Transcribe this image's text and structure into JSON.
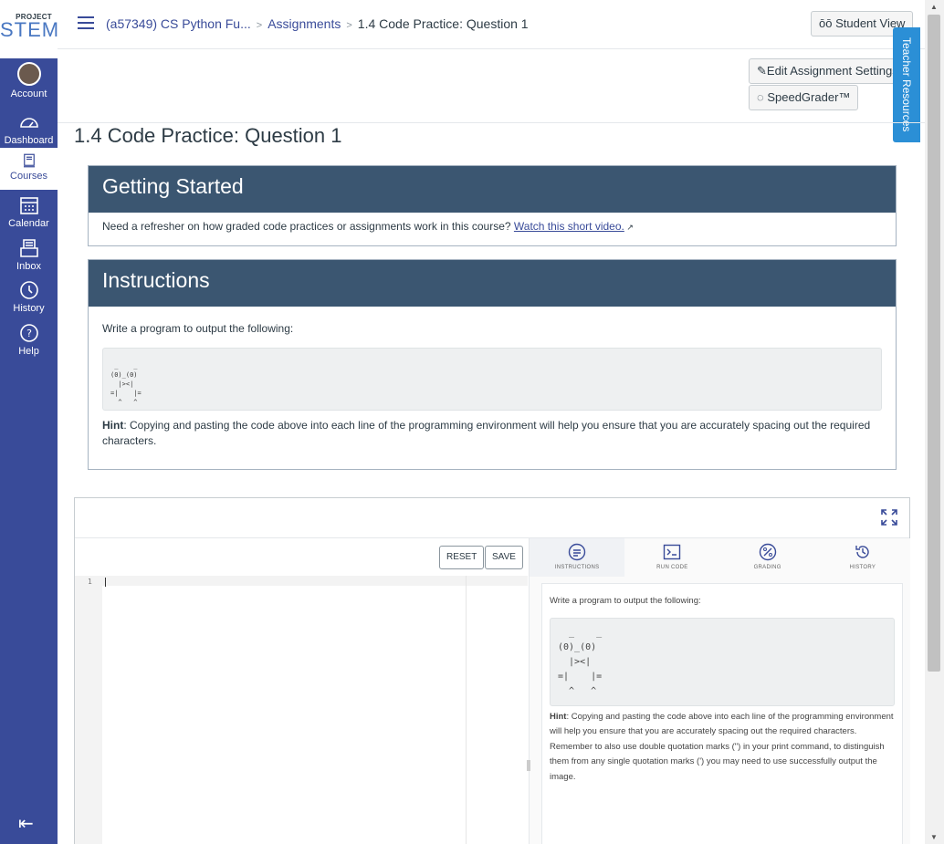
{
  "logo": {
    "top": "PROJECT",
    "bottom": "STEM"
  },
  "nav": {
    "account": "Account",
    "dashboard": "Dashboard",
    "courses": "Courses",
    "calendar": "Calendar",
    "inbox": "Inbox",
    "history": "History",
    "help": "Help"
  },
  "breadcrumb": {
    "course": "(a57349) CS Python Fu...",
    "assignments": "Assignments",
    "current": "1.4 Code Practice: Question 1"
  },
  "buttons": {
    "student_view": "Student View",
    "edit_settings": "Edit Assignment Settings",
    "speedgrader": "SpeedGrader™",
    "teacher_resources": "Teacher Resources"
  },
  "page_title": "1.4 Code Practice: Question 1",
  "getting_started": {
    "heading": "Getting Started",
    "text": "Need a refresher on how graded code practices or assignments work in this course? ",
    "link": "Watch this short video."
  },
  "instructions": {
    "heading": "Instructions",
    "prompt": "Write a program to output the following:",
    "code": " _    _\n(0)_(0)\n  |><|\n=|    |=\n  ^   ^",
    "hint_label": "Hint",
    "hint_text": ": Copying and pasting the code above into each line of the programming environment will help you ensure that you are accurately spacing out the required characters."
  },
  "ide": {
    "reset": "RESET",
    "save": "SAVE",
    "line_number": "1",
    "tabs": [
      "INSTRUCTIONS",
      "RUN CODE",
      "GRADING",
      "HISTORY"
    ],
    "pane_prompt": "Write a program to output the following:",
    "pane_code": "  _    _\n(0)_(0)\n  |><|\n=|    |=\n  ^   ^",
    "pane_hint_label": "Hint",
    "pane_hint_text": ": Copying and pasting the code above into each line of the programming environment will help you ensure that you are accurately spacing out the required characters.  Remember to also use double quotation marks (\") in your print command, to distinguish them from any single quotation marks (') you may need to use successfully output the image."
  },
  "colors": {
    "nav": "#394b99",
    "panel_header": "#3b5671",
    "teacher_resources": "#2b8fd6"
  }
}
